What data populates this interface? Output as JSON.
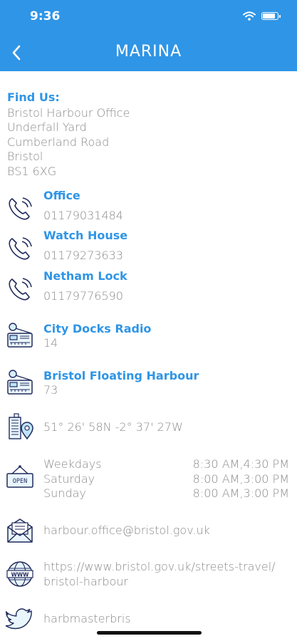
{
  "status_bar": {
    "time": "9:36",
    "battery_level": 0.85
  },
  "header": {
    "title": "MARINA",
    "back_icon": "chevron-left-icon"
  },
  "colors": {
    "header_bg": "#2f95e6",
    "accent": "#2f95e6",
    "text": "#8a8a8a",
    "icon_navy": "#1f2a5c"
  },
  "find_us": {
    "label": "Find Us:",
    "lines": [
      "Bristol Harbour Office",
      "Underfall Yard",
      "Cumberland Road",
      "Bristol",
      "BS1 6XG"
    ]
  },
  "phones": [
    {
      "label": "Office",
      "number": "01179031484",
      "icon": "phone-icon"
    },
    {
      "label": "Watch House",
      "number": "01179273633",
      "icon": "phone-icon"
    },
    {
      "label": "Netham Lock",
      "number": "01179776590",
      "icon": "phone-icon"
    }
  ],
  "radios": [
    {
      "label": "City Docks Radio",
      "channel": "14",
      "icon": "radio-icon"
    },
    {
      "label": "Bristol Floating Harbour",
      "channel": "73",
      "icon": "radio-icon"
    }
  ],
  "location": {
    "coordinates": "51° 26' 58N -2° 37' 27W",
    "icon": "map-pin-building-icon"
  },
  "opening_hours": {
    "icon": "open-sign-icon",
    "sign_text": "OPEN",
    "rows": [
      {
        "day": "Weekdays",
        "hours": "8:30 AM,4:30 PM"
      },
      {
        "day": "Saturday",
        "hours": "8:00 AM,3:00 PM"
      },
      {
        "day": "Sunday",
        "hours": "8:00 AM,3:00 PM"
      }
    ]
  },
  "email": {
    "address": "harbour.office@bristol.gov.uk",
    "icon": "envelope-icon"
  },
  "website": {
    "line1": "https://www.bristol.gov.uk/streets-travel/",
    "line2": "bristol-harbour",
    "icon": "globe-icon",
    "icon_text": "WWW"
  },
  "twitter": {
    "handle": "harbmasterbris",
    "icon": "twitter-icon"
  }
}
